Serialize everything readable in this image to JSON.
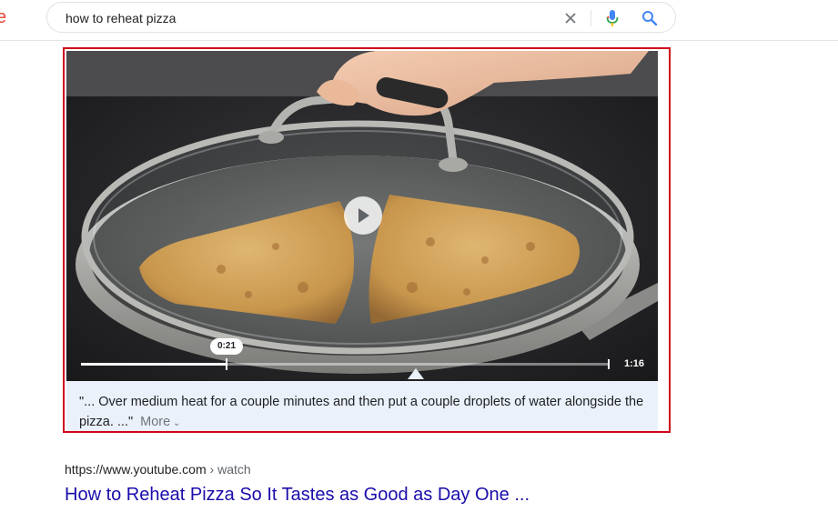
{
  "search": {
    "query": "how to reheat pizza"
  },
  "icons": {
    "clear": "close-icon",
    "mic": "microphone-icon",
    "search": "search-icon",
    "play": "play-icon"
  },
  "video": {
    "current_time": "0:21",
    "duration": "1:16",
    "progress": 0.276
  },
  "snippet": {
    "text": "\"... Over medium heat for a couple minutes and then put a couple droplets of water alongside the pizza. ...\"",
    "more_label": "More"
  },
  "result": {
    "url_domain": "https://www.youtube.com",
    "url_path": " › watch",
    "title": "How to Reheat Pizza So It Tastes as Good as Day One ..."
  },
  "colors": {
    "highlight_border": "#d0021b",
    "link": "#1a0dab",
    "caption_bg": "#eaf1fb"
  }
}
